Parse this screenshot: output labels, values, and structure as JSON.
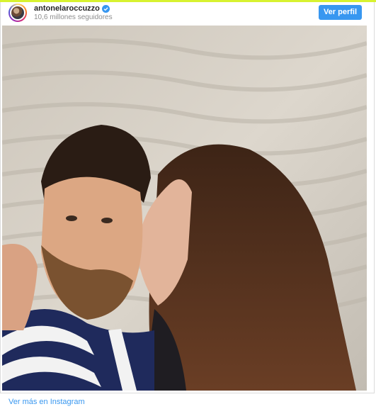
{
  "header": {
    "username": "antonelaroccuzzo",
    "verified_icon": "verified-badge-icon",
    "followers": "10,6 millones seguidores",
    "view_profile_label": "Ver perfil"
  },
  "post": {
    "image": "selfie-photo"
  },
  "footer": {
    "more_link": "Ver más en Instagram"
  },
  "colors": {
    "accent": "#3897f0",
    "top_bar": "#d8f230"
  }
}
